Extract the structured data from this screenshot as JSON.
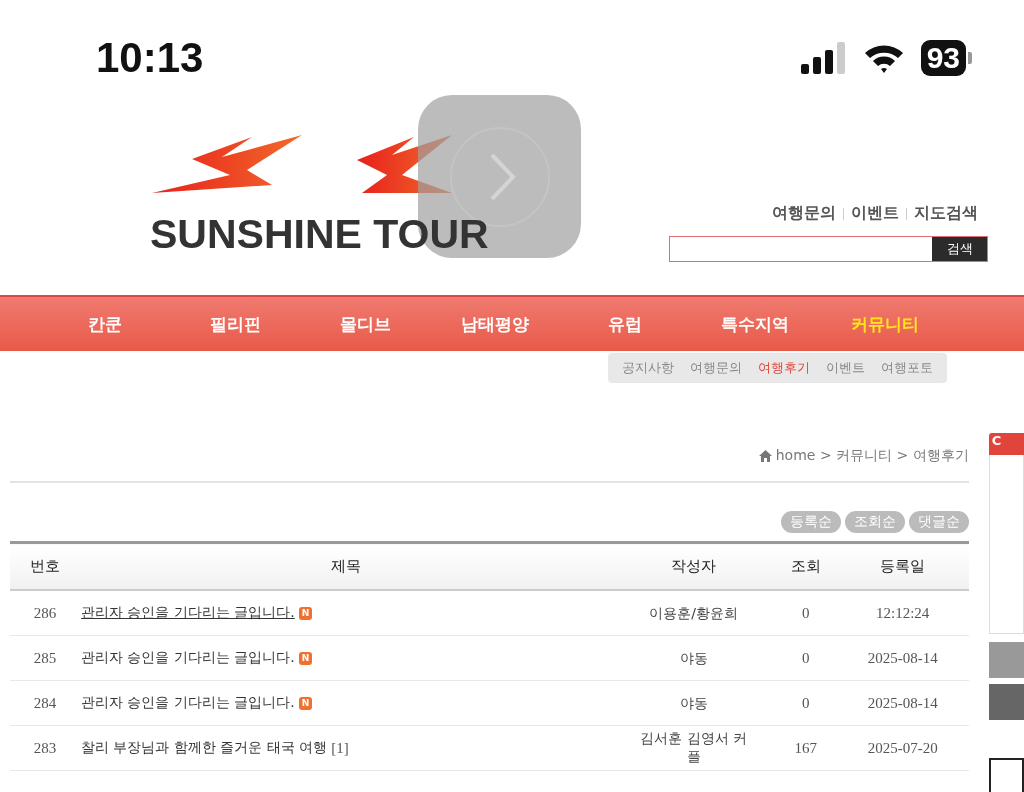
{
  "status_bar": {
    "time": "10:13",
    "battery": "93"
  },
  "logo": {
    "text": "SUNSHINE TOUR"
  },
  "top_links": [
    "여행문의",
    "이벤트",
    "지도검색"
  ],
  "search": {
    "button": "검색"
  },
  "nav": [
    {
      "label": "칸쿤",
      "selected": false
    },
    {
      "label": "필리핀",
      "selected": false
    },
    {
      "label": "몰디브",
      "selected": false
    },
    {
      "label": "남태평양",
      "selected": false
    },
    {
      "label": "유럽",
      "selected": false
    },
    {
      "label": "특수지역",
      "selected": false
    },
    {
      "label": "커뮤니티",
      "selected": true
    }
  ],
  "subnav": [
    {
      "label": "공지사항",
      "selected": false
    },
    {
      "label": "여행문의",
      "selected": false
    },
    {
      "label": "여행후기",
      "selected": true
    },
    {
      "label": "이벤트",
      "selected": false
    },
    {
      "label": "여행포토",
      "selected": false
    }
  ],
  "breadcrumb": "home > 커뮤니티 > 여행후기",
  "sort_buttons": [
    "등록순",
    "조회순",
    "댓글순"
  ],
  "table": {
    "columns": [
      "번호",
      "제목",
      "작성자",
      "조회",
      "등록일"
    ],
    "rows": [
      {
        "no": "286",
        "title": "관리자 승인을 기다리는 글입니다.",
        "underlined": true,
        "badge": "N",
        "author": "이용훈/황윤희",
        "views": "0",
        "date": "12:12:24"
      },
      {
        "no": "285",
        "title": "관리자 승인을 기다리는 글입니다.",
        "underlined": false,
        "badge": "N",
        "author": "야동",
        "views": "0",
        "date": "2025-08-14"
      },
      {
        "no": "284",
        "title": "관리자 승인을 기다리는 글입니다.",
        "underlined": false,
        "badge": "N",
        "author": "야동",
        "views": "0",
        "date": "2025-08-14"
      },
      {
        "no": "283",
        "title": "찰리 부장님과 함께한 즐거운 태국 여행",
        "underlined": false,
        "comments": "[1]",
        "author": "김서훈 김영서 커플",
        "views": "167",
        "date": "2025-07-20"
      }
    ]
  },
  "side_tab": "C"
}
